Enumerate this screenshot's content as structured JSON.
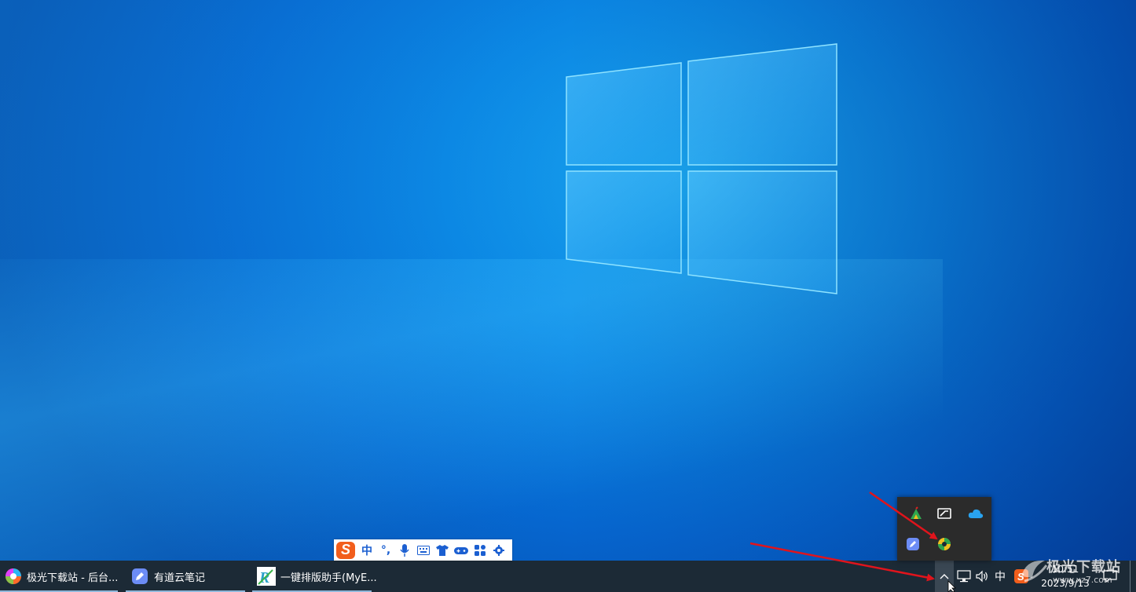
{
  "ime_toolbar": {
    "logo": "S",
    "mode_label": "中",
    "punct_label": "°,",
    "icons": [
      "microphone-icon",
      "keyboard-icon",
      "skin-icon",
      "game-icon",
      "apps-icon",
      "settings-icon"
    ]
  },
  "tray_flyout": {
    "icons": [
      "green-app-icon",
      "screen-icon",
      "cloud-icon",
      "note-icon",
      "myeditor-icon"
    ]
  },
  "taskbar": {
    "apps": [
      {
        "label": "极光下载站 - 后台...",
        "icon": "browser-icon"
      },
      {
        "label": "有道云笔记",
        "icon": "youdao-note-icon"
      },
      {
        "label": "一键排版助手(MyE...",
        "icon": "myeditor-icon"
      }
    ],
    "tray": {
      "ime_label": "中",
      "time": "10:51",
      "date": "2023/9/13"
    }
  },
  "watermark": {
    "text": "极光下载站",
    "url": "www.xz7.com"
  },
  "colors": {
    "taskbar_bg": "#1c2a36",
    "flyout_bg": "#2b2b2b",
    "desktop_blue": "#0b86e3",
    "arrow_red": "#e0141c",
    "ime_blue": "#1b5fd1",
    "sogou_orange": "#f25e1c"
  }
}
